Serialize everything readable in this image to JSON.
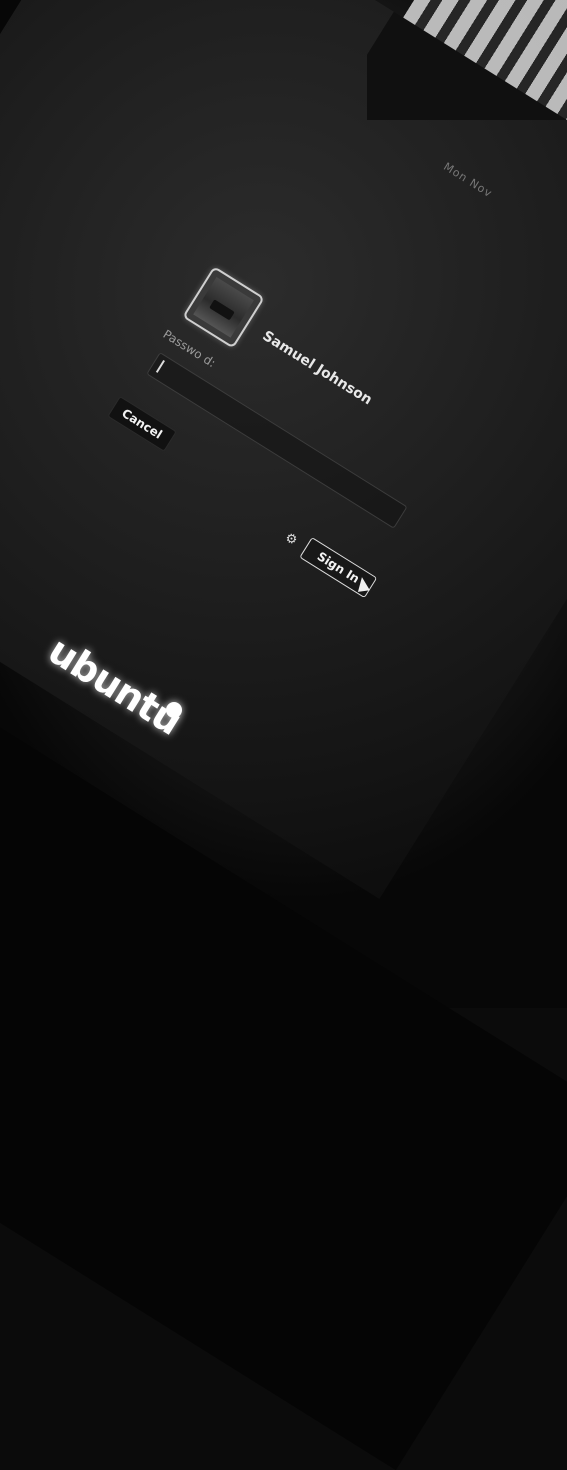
{
  "top_bar": {
    "status_text": "Mon Nov"
  },
  "login": {
    "user_name": "Samuel Johnson",
    "password_label": "Passwo d:",
    "password_value": "",
    "cancel_label": "Cancel",
    "sign_in_label": "Sign In"
  },
  "brand": {
    "logo_text": "ubuntu"
  },
  "icons": {
    "gear": "gear-icon",
    "cursor": "mouse-cursor-icon",
    "avatar": "user-avatar"
  },
  "colors": {
    "background": "#1f1f1f",
    "text": "#e8e8e8"
  }
}
